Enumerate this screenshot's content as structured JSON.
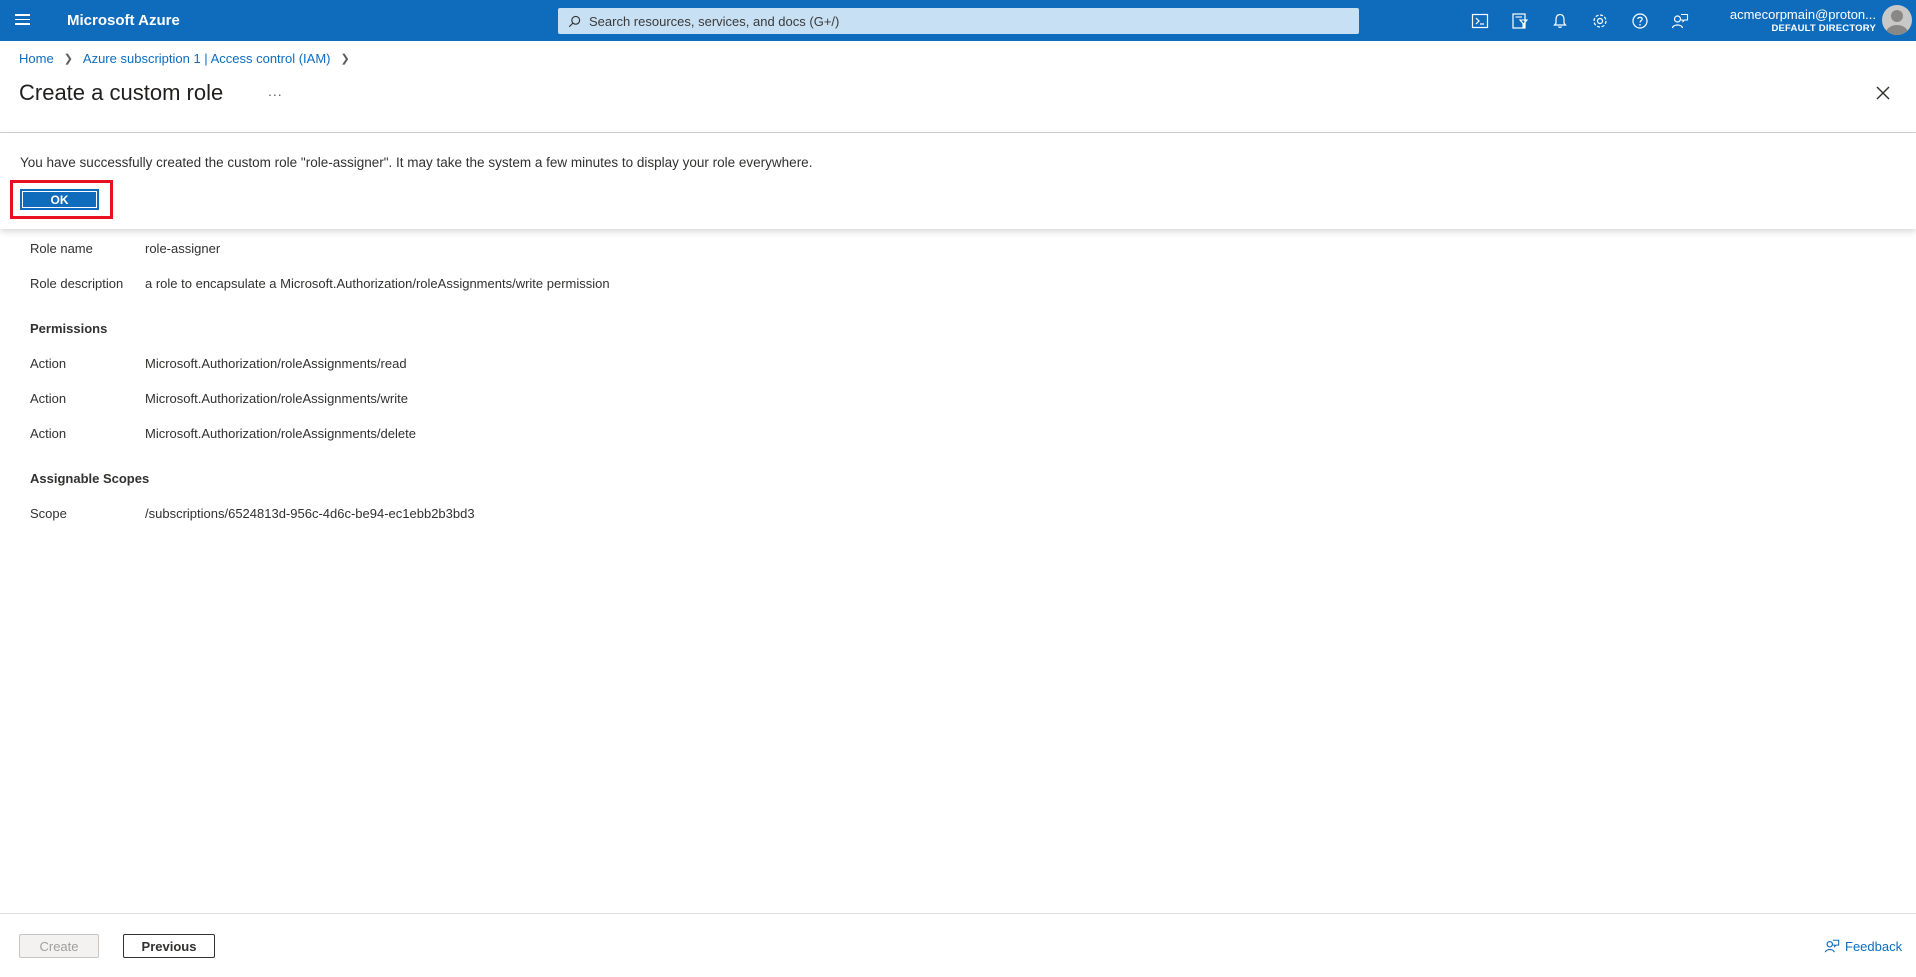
{
  "topbar": {
    "brand": "Microsoft Azure",
    "search_placeholder": "Search resources, services, and docs (G+/)",
    "icons": [
      "cloud-shell-icon",
      "directory-filter-icon",
      "notifications-icon",
      "settings-icon",
      "help-icon",
      "feedback-icon"
    ],
    "account_email": "acmecorpmain@proton...",
    "account_directory": "DEFAULT DIRECTORY",
    "bar_color": "#0f6cbd"
  },
  "breadcrumb": {
    "items": [
      "Home",
      "Azure subscription 1 | Access control (IAM)"
    ]
  },
  "header": {
    "title": "Create a custom role",
    "more": "..."
  },
  "success": {
    "message": "You have successfully created the custom role \"role-assigner\". It may take the system a few minutes to display your role everywhere.",
    "ok_label": "OK",
    "highlight_color": "#e81123"
  },
  "details": {
    "role_name_label": "Role name",
    "role_name_value": "role-assigner",
    "role_description_label": "Role description",
    "role_description_value": "a role to encapsulate a Microsoft.Authorization/roleAssignments/write permission",
    "permissions_heading": "Permissions",
    "permissions": [
      {
        "label": "Action",
        "value": "Microsoft.Authorization/roleAssignments/read"
      },
      {
        "label": "Action",
        "value": "Microsoft.Authorization/roleAssignments/write"
      },
      {
        "label": "Action",
        "value": "Microsoft.Authorization/roleAssignments/delete"
      }
    ],
    "scopes_heading": "Assignable Scopes",
    "scope_label": "Scope",
    "scope_value": "/subscriptions/6524813d-956c-4d6c-be94-ec1ebb2b3bd3"
  },
  "footer": {
    "create_label": "Create",
    "previous_label": "Previous",
    "feedback_label": "Feedback"
  }
}
